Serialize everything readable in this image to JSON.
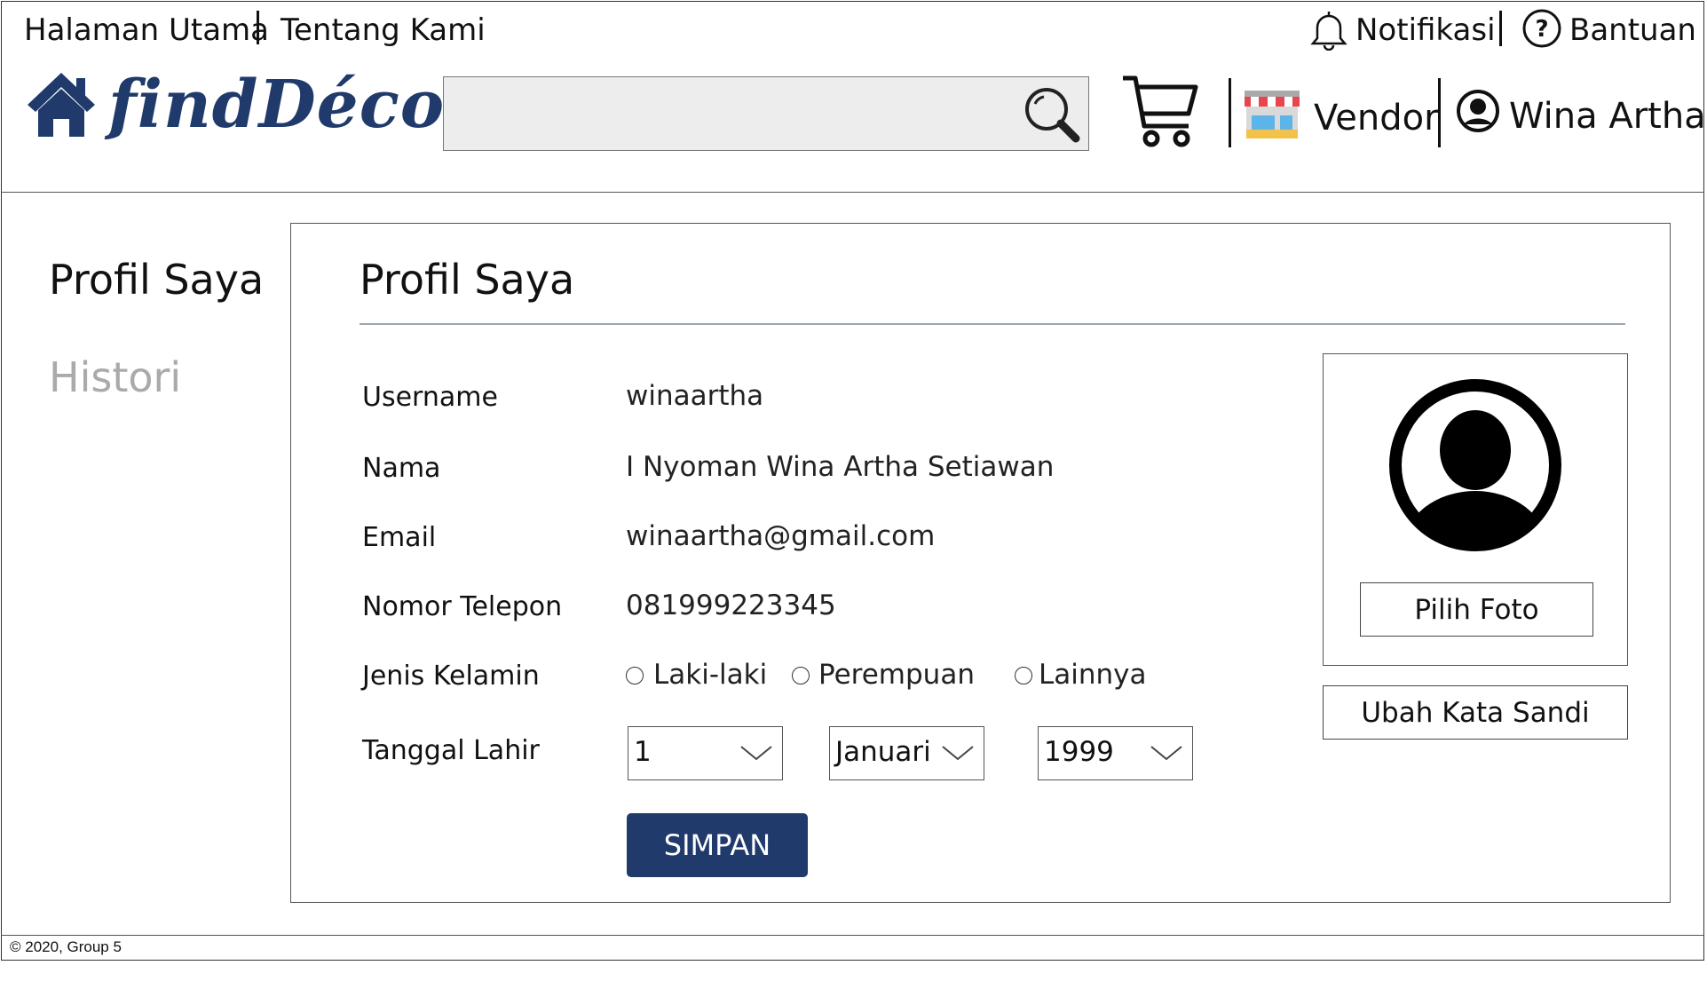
{
  "topnav": {
    "home": "Halaman Utama",
    "about": "Tentang Kami",
    "notifications": "Notifikasi",
    "help": "Bantuan"
  },
  "brand": {
    "logo_text": "findDécor",
    "color": "#1f3a6b"
  },
  "search": {
    "placeholder": "",
    "value": ""
  },
  "header_actions": {
    "vendor": "Vendor",
    "user_name": "Wina Artha"
  },
  "sidebar": {
    "items": [
      {
        "label": "Profil Saya",
        "active": true
      },
      {
        "label": "Histori",
        "active": false
      }
    ]
  },
  "profile": {
    "title": "Profil Saya",
    "fields": {
      "username": {
        "label": "Username",
        "value": "winaartha"
      },
      "name": {
        "label": "Nama",
        "value": "I Nyoman Wina Artha Setiawan"
      },
      "email": {
        "label": "Email",
        "value": "winaartha@gmail.com"
      },
      "phone": {
        "label": "Nomor Telepon",
        "value": "081999223345"
      }
    },
    "gender": {
      "label": "Jenis Kelamin",
      "options": [
        "Laki-laki",
        "Perempuan",
        "Lainnya"
      ],
      "selected": null
    },
    "birthdate": {
      "label": "Tanggal Lahir",
      "day": "1",
      "month": "Januari",
      "year": "1999"
    },
    "save_label": "SIMPAN",
    "choose_photo_label": "Pilih Foto",
    "change_password_label": "Ubah Kata Sandi"
  },
  "footer": {
    "text": "© 2020, Group 5"
  },
  "colors": {
    "primary": "#1f3a6b",
    "muted_text": "#aaaaaa",
    "search_bg": "#ededed"
  }
}
